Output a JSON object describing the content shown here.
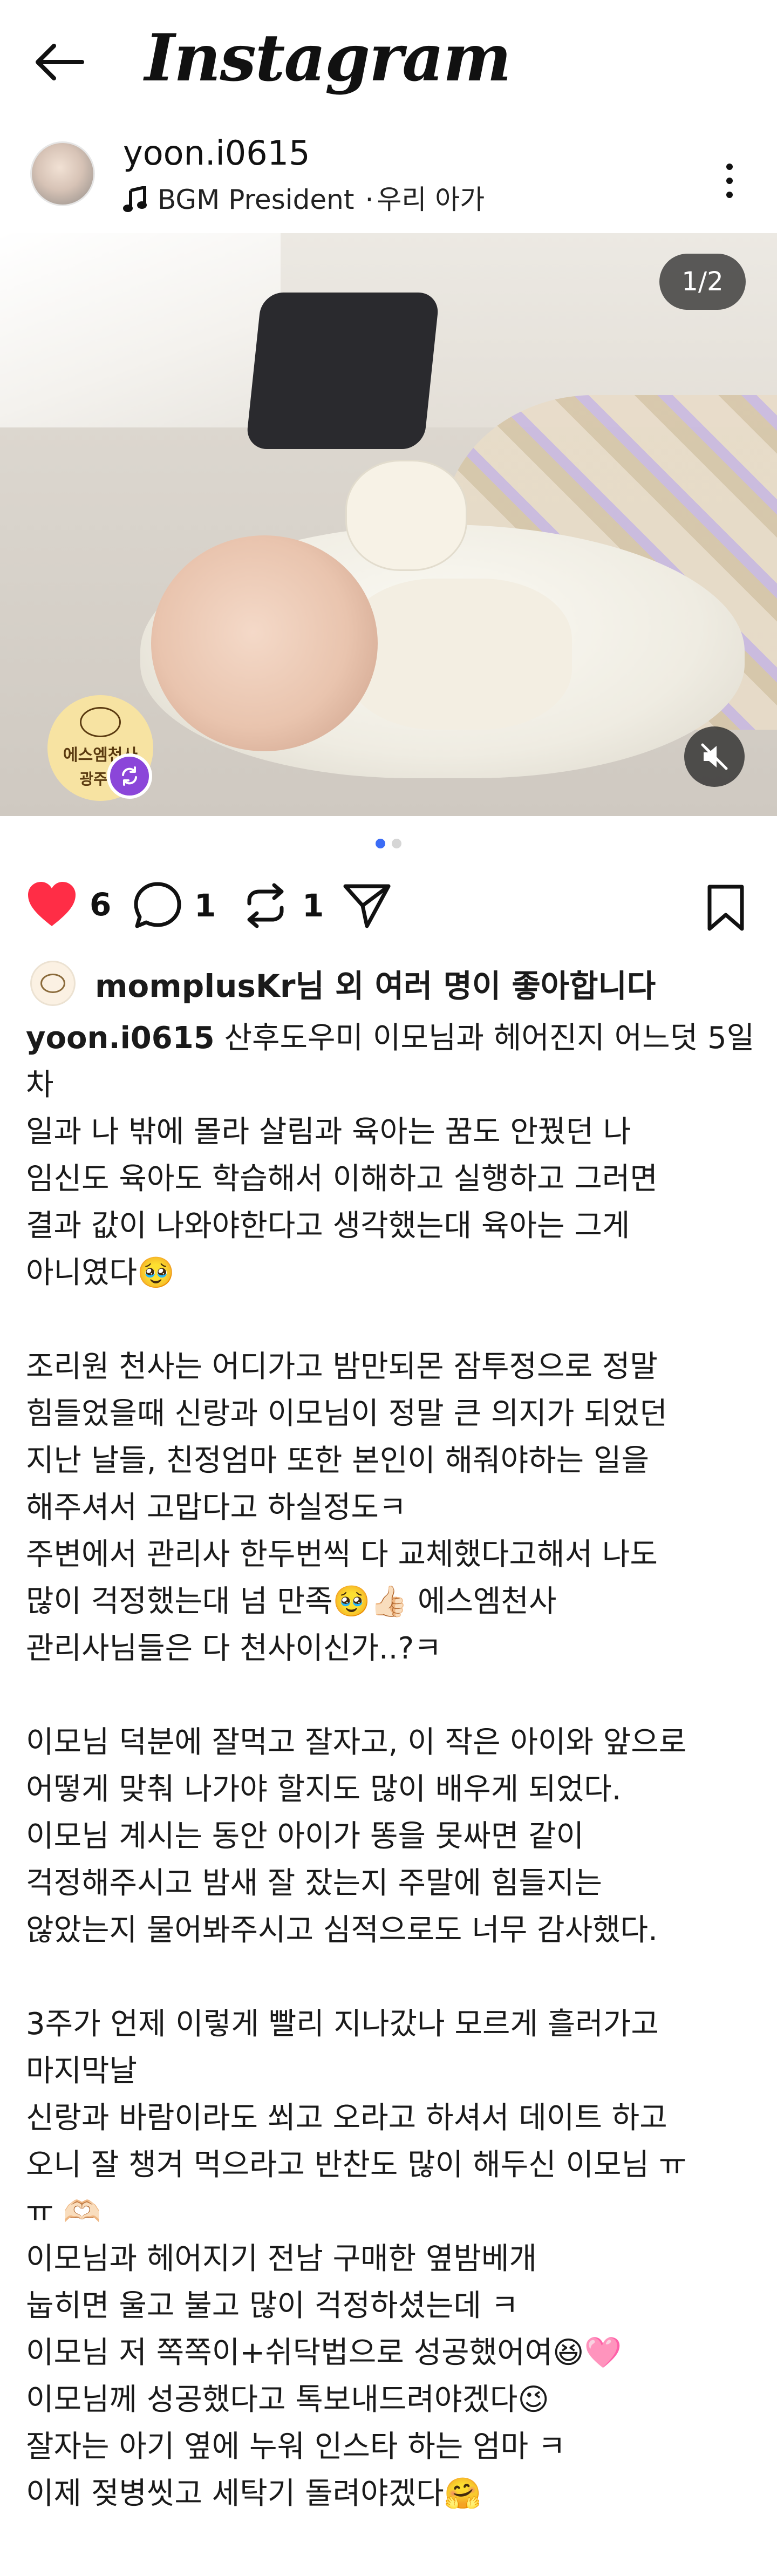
{
  "app": {
    "title": "Instagram"
  },
  "post": {
    "username": "yoon.i0615",
    "music": "BGM President",
    "location_sep": "·",
    "location": "우리 아가",
    "media_counter": "1/2",
    "brand_badge": {
      "line1": "에스엠천사",
      "line2": "광주점"
    }
  },
  "actions": {
    "likes_count": "6",
    "comments_count": "1",
    "reposts_count": "1"
  },
  "likes_summary": "momplusKr님 외 여러 명이 좋아합니다",
  "caption": {
    "author": "yoon.i0615",
    "first_line": " 산후도우미 이모님과 헤어진지 어느덧 5일차",
    "body": "일과 나 밖에 몰라 살림과 육아는 꿈도 안꿨던 나\n임신도 육아도 학습해서 이해하고 실행하고 그러면\n결과 값이 나와야한다고 생각했는대 육아는 그게\n아니였다🥹\n\n조리원 천사는 어디가고 밤만되몬 잠투정으로 정말\n힘들었을때 신랑과 이모님이 정말 큰 의지가 되었던\n지난 날들, 친정엄마 또한 본인이 해줘야하는 일을\n해주셔서 고맙다고 하실정도ㅋ\n주변에서 관리사 한두번씩 다 교체했다고해서 나도\n많이 걱정했는대 넘 만족🥹👍🏻 에스엠천사\n관리사님들은 다 천사이신가..?ㅋ\n\n이모님 덕분에 잘먹고 잘자고, 이 작은 아이와 앞으로\n어떻게 맞춰 나가야 할지도 많이 배우게 되었다.\n이모님 계시는 동안 아이가 똥을 못싸면 같이\n걱정해주시고 밤새 잘 잤는지 주말에 힘들지는\n않았는지 물어봐주시고 심적으로도 너무 감사했다.\n\n3주가 언제 이렇게 빨리 지나갔나 모르게 흘러가고\n마지막날\n신랑과 바람이라도 쐬고 오라고 하셔서 데이트 하고\n오니 잘 챙겨 먹으라고 반찬도 많이 해두신 이모님 ㅠ\nㅠ 🫶🏻\n이모님과 헤어지기 전남 구매한 옆밤베개\n눕히면 울고 불고 많이 걱정하셨는데 ㅋ\n이모님 저 쪽쪽이+쉬닥법으로 성공했어여😆🩷\n이모님께 성공했다고 톡보내드려야겠다😉\n잘자는 아기 옆에 누워 인스타 하는 엄마 ㅋ\n이제 젖병씻고 세탁기 돌려야겠다🤗"
  },
  "carousel": {
    "total": 2,
    "active": 1
  }
}
